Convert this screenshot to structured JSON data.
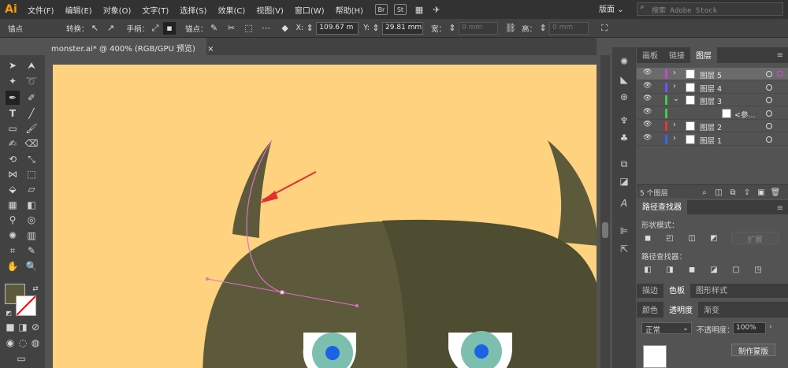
{
  "app": {
    "logo": "Ai"
  },
  "menus": [
    "文件(F)",
    "编辑(E)",
    "对象(O)",
    "文字(T)",
    "选择(S)",
    "效果(C)",
    "视图(V)",
    "窗口(W)",
    "帮助(H)"
  ],
  "menu_buttons": [
    "Br",
    "St"
  ],
  "workspace": {
    "label": "版面"
  },
  "stock_search": {
    "placeholder": "搜索 Adobe Stock"
  },
  "control_bar": {
    "mode_label": "锚点",
    "convert_label": "转换：",
    "handle_label": "手柄：",
    "anchor_label": "锚点：",
    "x_label": "X:",
    "x_value": "109.67 m",
    "y_label": "Y:",
    "y_value": "29.81 mm",
    "width_label": "宽：",
    "width_value": "0 mm",
    "height_label": "高：",
    "height_value": "0 mm"
  },
  "document_tab": {
    "title": "monster.ai* @ 400% (RGB/GPU 预览)",
    "close": "×"
  },
  "layers_panel": {
    "tabs": [
      "画板",
      "链接",
      "图层"
    ],
    "active_tab": "图层",
    "layers": [
      {
        "name": "图层 5",
        "color": "#cc44cc",
        "expanded": false,
        "selected": true
      },
      {
        "name": "图层 4",
        "color": "#7a4cff",
        "expanded": false,
        "selected": false
      },
      {
        "name": "图层 3",
        "color": "#44cc44",
        "expanded": true,
        "selected": false
      },
      {
        "name": "<参...",
        "color": "#44cc44",
        "expanded": false,
        "selected": false,
        "sublayer": true
      },
      {
        "name": "图层 2",
        "color": "#ee3333",
        "expanded": false,
        "selected": false
      },
      {
        "name": "图层 1",
        "color": "#3366ff",
        "expanded": false,
        "selected": false
      }
    ],
    "count": "5 个图层"
  },
  "pathfinder_panel": {
    "title": "路径查找器",
    "shape_modes_label": "形状模式：",
    "expand_button": "扩展",
    "pathfinders_label": "路径查找器："
  },
  "color_panel": {
    "tabs_top": [
      "描边",
      "色板",
      "图形样式"
    ],
    "tabs_bottom": [
      "颜色",
      "透明度",
      "渐变"
    ],
    "blend_mode": "正常",
    "opacity_label": "不透明度：",
    "opacity_value": "100%",
    "make_mask_button": "制作蒙版"
  },
  "tool_colors": {
    "fill": "#5c5a3a"
  },
  "artwork": {
    "bg": "#ffd27f",
    "head": "#5c5a3a",
    "head_dark": "#4e4c31",
    "eye_outer": "#7dbfae",
    "eye_pupil": "#1a63e6"
  }
}
